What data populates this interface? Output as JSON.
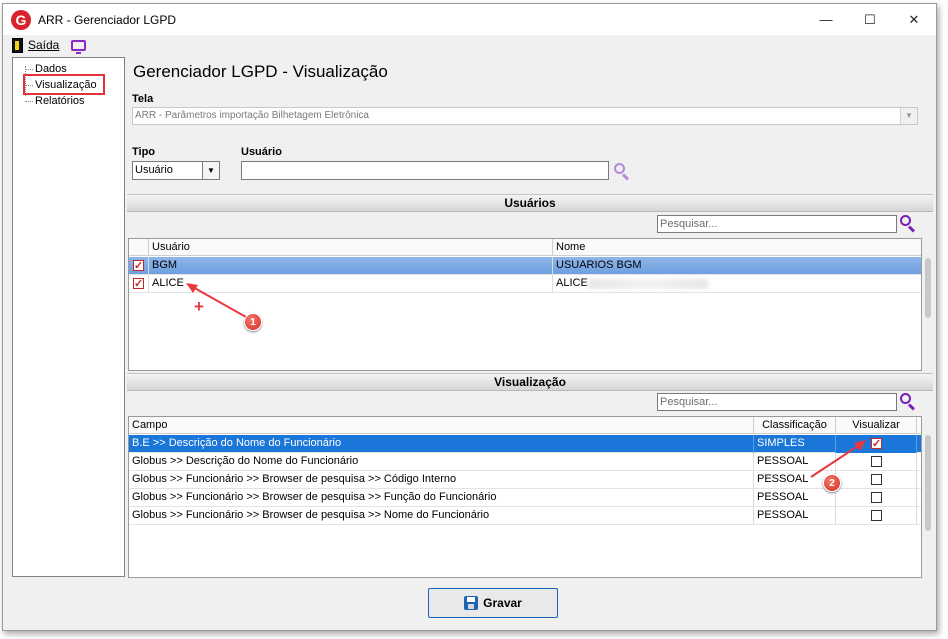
{
  "window": {
    "title": "ARR - Gerenciador LGPD",
    "app_icon_letter": "G",
    "minimize_glyph": "—",
    "maximize_glyph": "☐",
    "close_glyph": "✕"
  },
  "menu": {
    "exit_label": "Saída"
  },
  "tree": {
    "items": [
      {
        "label": "Dados"
      },
      {
        "label": "Visualização"
      },
      {
        "label": "Relatórios"
      }
    ]
  },
  "page": {
    "heading": "Gerenciador LGPD - Visualização",
    "tela_label": "Tela",
    "tela_value": "ARR - Parâmetros importação Bilhetagem Eletrônica",
    "tipo_label": "Tipo",
    "tipo_value": "Usuário",
    "usuario_label": "Usuário",
    "usuario_value": ""
  },
  "usuarios_section": {
    "title": "Usuários",
    "search_placeholder": "Pesquisar...",
    "columns": [
      "Usuário",
      "Nome"
    ],
    "rows": [
      {
        "user": "BGM",
        "name": "USUARIOS BGM",
        "checked": true
      },
      {
        "user": "ALICE",
        "name": "ALICE",
        "checked": true
      }
    ]
  },
  "visualizacao_section": {
    "title": "Visualização",
    "search_placeholder": "Pesquisar...",
    "columns": [
      "Campo",
      "Classificação",
      "Visualizar"
    ],
    "rows": [
      {
        "campo": "B.E >> Descrição do Nome do Funcionário",
        "classificacao": "SIMPLES",
        "visualizar": true
      },
      {
        "campo": "Globus >> Descrição do Nome do Funcionário",
        "classificacao": "PESSOAL",
        "visualizar": false
      },
      {
        "campo": "Globus >> Funcionário >> Browser de pesquisa >> Código Interno",
        "classificacao": "PESSOAL",
        "visualizar": false
      },
      {
        "campo": "Globus >> Funcionário >> Browser de pesquisa >> Função do Funcionário",
        "classificacao": "PESSOAL",
        "visualizar": false
      },
      {
        "campo": "Globus >> Funcionário >> Browser de pesquisa >> Nome do Funcionário",
        "classificacao": "PESSOAL",
        "visualizar": false
      }
    ]
  },
  "footer": {
    "save_label": "Gravar"
  },
  "annotations": {
    "badge1": "1",
    "badge2": "2",
    "plus": "+"
  },
  "colors": {
    "accent_red": "#e0343a",
    "selection_blue": "#1a76d8",
    "search_icon_purple": "#8b28c8"
  }
}
